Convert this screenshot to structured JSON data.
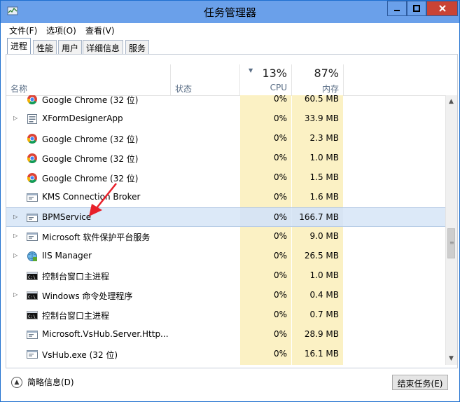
{
  "window": {
    "title": "任务管理器"
  },
  "menu": {
    "items": [
      "文件(F)",
      "选项(O)",
      "查看(V)"
    ]
  },
  "tabs": [
    "进程",
    "性能",
    "用户",
    "详细信息",
    "服务"
  ],
  "columns": {
    "name": "名称",
    "status": "状态",
    "cpu_pct": "13%",
    "cpu": "CPU",
    "mem_pct": "87%",
    "mem": "内存"
  },
  "rows": [
    {
      "name": "Google Chrome (32 位)",
      "icon": "chrome-icon",
      "expand": false,
      "cpu": "0%",
      "mem": "60.5 MB"
    },
    {
      "name": "XFormDesignerApp",
      "icon": "form-app-icon",
      "expand": true,
      "cpu": "0%",
      "mem": "33.9 MB"
    },
    {
      "name": "Google Chrome (32 位)",
      "icon": "chrome-icon",
      "expand": false,
      "cpu": "0%",
      "mem": "2.3 MB"
    },
    {
      "name": "Google Chrome (32 位)",
      "icon": "chrome-icon",
      "expand": false,
      "cpu": "0%",
      "mem": "1.0 MB"
    },
    {
      "name": "Google Chrome (32 位)",
      "icon": "chrome-icon",
      "expand": false,
      "cpu": "0%",
      "mem": "1.5 MB"
    },
    {
      "name": "KMS Connection Broker",
      "icon": "window-app-icon",
      "expand": false,
      "cpu": "0%",
      "mem": "1.6 MB"
    },
    {
      "name": "BPMService",
      "icon": "window-app-icon",
      "expand": true,
      "cpu": "0%",
      "mem": "166.7 MB",
      "selected": true
    },
    {
      "name": "Microsoft 软件保护平台服务",
      "icon": "window-app-icon",
      "expand": true,
      "cpu": "0%",
      "mem": "9.0 MB"
    },
    {
      "name": "IIS Manager",
      "icon": "iis-icon",
      "expand": true,
      "cpu": "0%",
      "mem": "26.5 MB"
    },
    {
      "name": "控制台窗口主进程",
      "icon": "console-icon",
      "expand": false,
      "cpu": "0%",
      "mem": "1.0 MB"
    },
    {
      "name": "Windows 命令处理程序",
      "icon": "console-icon",
      "expand": true,
      "cpu": "0%",
      "mem": "0.4 MB"
    },
    {
      "name": "控制台窗口主进程",
      "icon": "console-icon",
      "expand": false,
      "cpu": "0%",
      "mem": "0.7 MB"
    },
    {
      "name": "Microsoft.VsHub.Server.Http...",
      "icon": "window-app-icon",
      "expand": false,
      "cpu": "0%",
      "mem": "28.9 MB"
    },
    {
      "name": "VsHub.exe (32 位)",
      "icon": "window-app-icon",
      "expand": false,
      "cpu": "0%",
      "mem": "16.1 MB"
    }
  ],
  "footer": {
    "fewer_details": "简略信息(D)",
    "end_task": "结束任务(E)"
  },
  "colors": {
    "titlebar": "#6aa0ea",
    "close": "#c94335",
    "heat": "#fbf1c4",
    "selected": "#dce9f8",
    "annotation_arrow": "#e8202a"
  }
}
